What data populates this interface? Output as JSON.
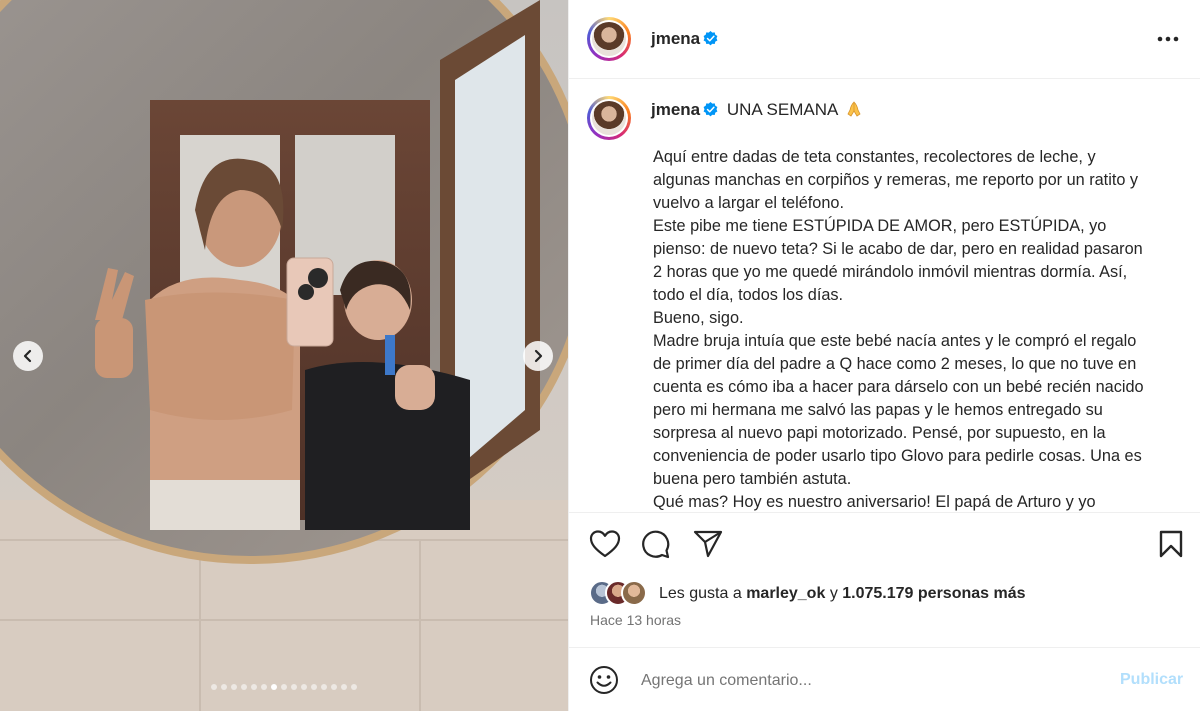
{
  "post": {
    "username": "jmena",
    "caption_title": "UNA SEMANA",
    "caption_paragraphs": [
      "Aquí entre dadas de teta constantes, recolectores de leche, y algunas manchas en corpiños y remeras, me reporto por un ratito y vuelvo a largar el teléfono.",
      "Este pibe me tiene ESTÚPIDA DE AMOR, pero ESTÚPIDA, yo pienso: de nuevo teta? Si le acabo de dar, pero en realidad pasaron 2 horas que yo me quedé mirándolo inmóvil mientras dormía. Así, todo el día, todos los días.",
      "Bueno, sigo.",
      "Madre bruja intuía que este bebé nacía antes y le compró el regalo de primer día del padre a Q hace como 2 meses, lo que no tuve en cuenta es cómo iba a hacer para dárselo con un bebé recién nacido pero mi hermana me salvó las papas y le hemos entregado su sorpresa al nuevo papi motorizado. Pensé, por supuesto, en la conveniencia de poder usarlo tipo Glovo para pedirle cosas. Una es buena pero también astuta.",
      "Qué mas? Hoy es nuestro aniversario! El papá de Arturo y yo"
    ],
    "likes": {
      "prefix": "Les gusta a",
      "user": "marley_ok",
      "connector": "y",
      "count": "1.075.179 personas más"
    },
    "time_ago": "Hace 13 horas"
  },
  "comment": {
    "placeholder": "Agrega un comentario...",
    "publish_label": "Publicar"
  },
  "carousel": {
    "total_slides": 15,
    "active_index": 6
  },
  "colors": {
    "verified": "#0095f6",
    "publish_disabled": "#b2dffc"
  },
  "icons": {
    "more": "more-icon",
    "like": "heart-icon",
    "comment": "comment-icon",
    "share": "send-icon",
    "save": "bookmark-icon",
    "emoji": "emoji-icon",
    "prev": "chevron-left-icon",
    "next": "chevron-right-icon"
  }
}
